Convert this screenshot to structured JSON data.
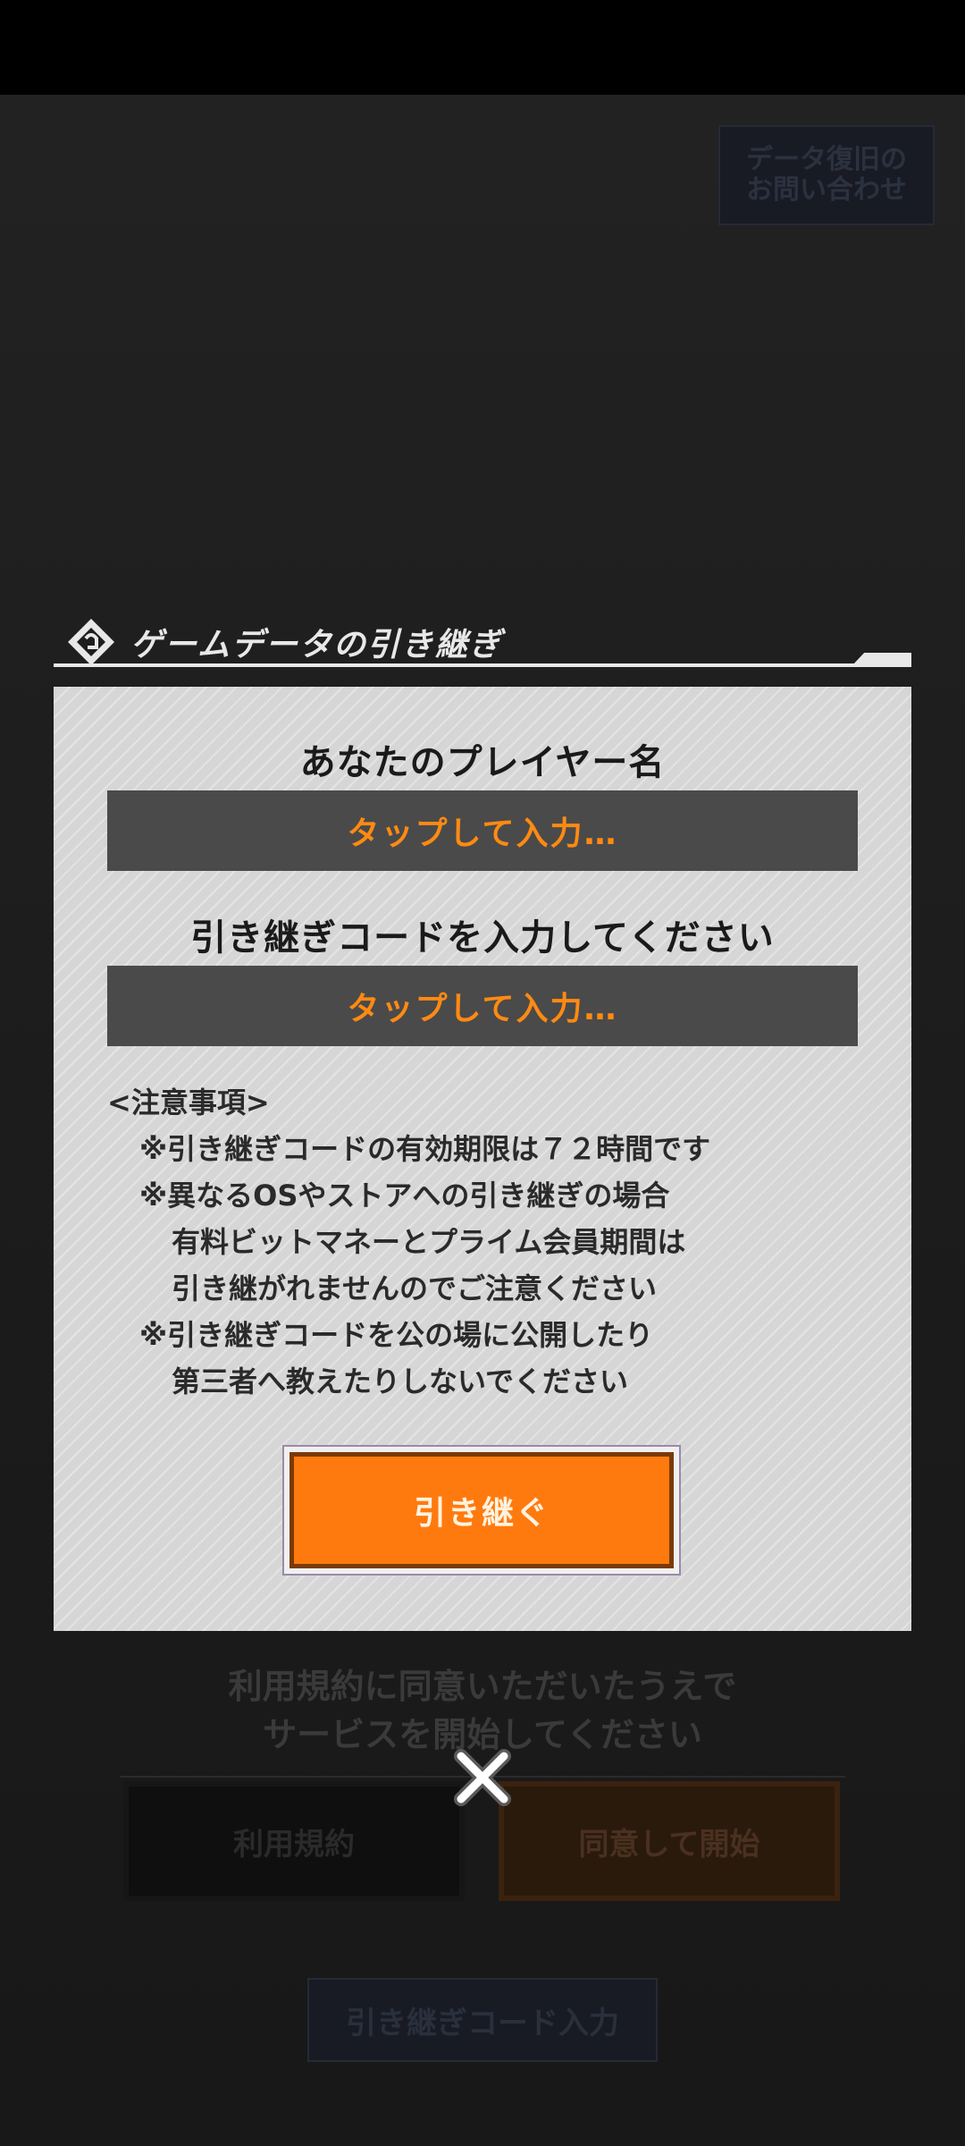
{
  "background": {
    "recovery_button": {
      "line1": "データ復旧の",
      "line2": "お問い合わせ"
    },
    "terms_text": {
      "line1": "利用規約に同意いただいたうえで",
      "line2": "サービスを開始してください"
    },
    "terms_button": "利用規約",
    "agree_button": "同意して開始",
    "code_input_button": "引き継ぎコード入力"
  },
  "dialog": {
    "title": "ゲームデータの引き継ぎ",
    "player_name_label": "あなたのプレイヤー名",
    "player_name_placeholder": "タップして入力…",
    "code_label": "引き継ぎコードを入力してください",
    "code_placeholder": "タップして入力…",
    "notes_title": "<注意事項>",
    "notes": [
      "※引き継ぎコードの有効期限は７２時間です",
      "※異なるOSやストアへの引き継ぎの場合",
      "有料ビットマネーとプライム会員期間は",
      "引き継がれませんのでご注意ください",
      "※引き継ぎコードを公の場に公開したり",
      "第三者へ教えたりしないでください"
    ],
    "submit_label": "引き継ぐ",
    "close_icon": "close-icon"
  },
  "colors": {
    "accent_orange": "#ff7a0e",
    "placeholder_orange": "#ff8a12",
    "panel_bg": "#d6d6d6"
  }
}
